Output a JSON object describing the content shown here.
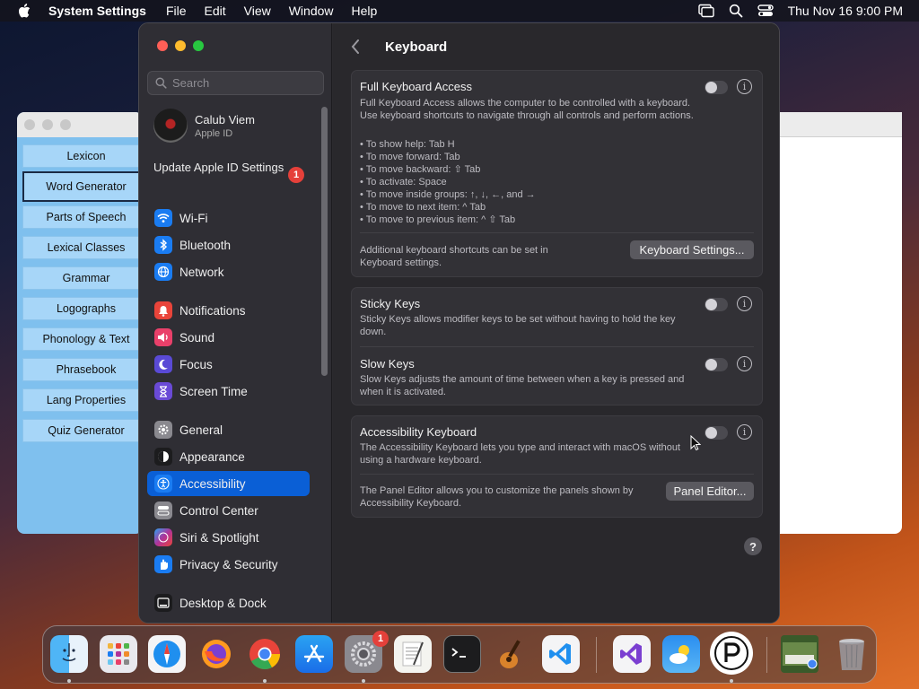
{
  "menubar": {
    "app_name": "System Settings",
    "menus": [
      "File",
      "Edit",
      "View",
      "Window",
      "Help"
    ],
    "clock": "Thu Nov 16  9:00 PM"
  },
  "background_app": {
    "nav": [
      "Lexicon",
      "Word Generator",
      "Parts of Speech",
      "Lexical Classes",
      "Grammar",
      "Logographs",
      "Phonology & Text",
      "Phrasebook",
      "Lang Properties",
      "Quiz Generator"
    ],
    "selected": "Word Generator"
  },
  "sidebar": {
    "search_placeholder": "Search",
    "profile_name": "Calub Viem",
    "profile_sub": "Apple ID",
    "update_label": "Update Apple ID Settings",
    "update_badge": "1",
    "items": [
      {
        "label": "Wi-Fi",
        "icon": "wifi-icon",
        "color": "#1a7cf2"
      },
      {
        "label": "Bluetooth",
        "icon": "bluetooth-icon",
        "color": "#1a7cf2"
      },
      {
        "label": "Network",
        "icon": "globe-icon",
        "color": "#1a7cf2"
      },
      {
        "label": "Notifications",
        "icon": "bell-icon",
        "color": "#e9443a"
      },
      {
        "label": "Sound",
        "icon": "speaker-icon",
        "color": "#e9406a"
      },
      {
        "label": "Focus",
        "icon": "moon-icon",
        "color": "#5a4ad6"
      },
      {
        "label": "Screen Time",
        "icon": "hourglass-icon",
        "color": "#6a4ad6"
      },
      {
        "label": "General",
        "icon": "gear-icon",
        "color": "#8a898f"
      },
      {
        "label": "Appearance",
        "icon": "appearance-icon",
        "color": "#1c1c1e"
      },
      {
        "label": "Accessibility",
        "icon": "accessibility-icon",
        "color": "#1a7cf2"
      },
      {
        "label": "Control Center",
        "icon": "control-center-icon",
        "color": "#8a898f"
      },
      {
        "label": "Siri & Spotlight",
        "icon": "siri-icon",
        "color": "#b0339a"
      },
      {
        "label": "Privacy & Security",
        "icon": "hand-icon",
        "color": "#1a7cf2"
      },
      {
        "label": "Desktop & Dock",
        "icon": "dock-icon",
        "color": "#1c1c1e"
      }
    ],
    "active": "Accessibility"
  },
  "content": {
    "title": "Keyboard",
    "full_access": {
      "title": "Full Keyboard Access",
      "desc": "Full Keyboard Access allows the computer to be controlled with a keyboard. Use keyboard shortcuts to navigate through all controls and perform actions.",
      "bullets": [
        "• To show help: Tab H",
        "• To move forward: Tab",
        "• To move backward: ⇧ Tab",
        "• To activate: Space",
        "• To move inside groups: ↑, ↓, ←, and →",
        "• To move to next item: ^ Tab",
        "• To move to previous item: ^ ⇧ Tab"
      ],
      "footer": "Additional keyboard shortcuts can be set in Keyboard settings.",
      "button": "Keyboard Settings...",
      "enabled": false
    },
    "sticky_keys": {
      "title": "Sticky Keys",
      "desc": "Sticky Keys allows modifier keys to be set without having to hold the key down.",
      "enabled": false
    },
    "slow_keys": {
      "title": "Slow Keys",
      "desc": "Slow Keys adjusts the amount of time between when a key is pressed and when it is activated.",
      "enabled": false
    },
    "accessibility_keyboard": {
      "title": "Accessibility Keyboard",
      "desc": "The Accessibility Keyboard lets you type and interact with macOS without using a hardware keyboard.",
      "footer": "The Panel Editor allows you to customize the panels shown by Accessibility Keyboard.",
      "button": "Panel Editor...",
      "enabled": false
    },
    "help_label": "?"
  },
  "dock": {
    "apps": [
      "finder-icon",
      "launchpad-icon",
      "safari-icon",
      "firefox-icon",
      "chrome-icon",
      "app-store-icon",
      "system-settings-icon",
      "textedit-icon",
      "terminal-icon",
      "garageband-icon",
      "vscode-icon",
      "visual-studio-icon",
      "weather-icon",
      "p-app-icon",
      "preview-icon",
      "trash-icon"
    ],
    "settings_badge": "1"
  }
}
